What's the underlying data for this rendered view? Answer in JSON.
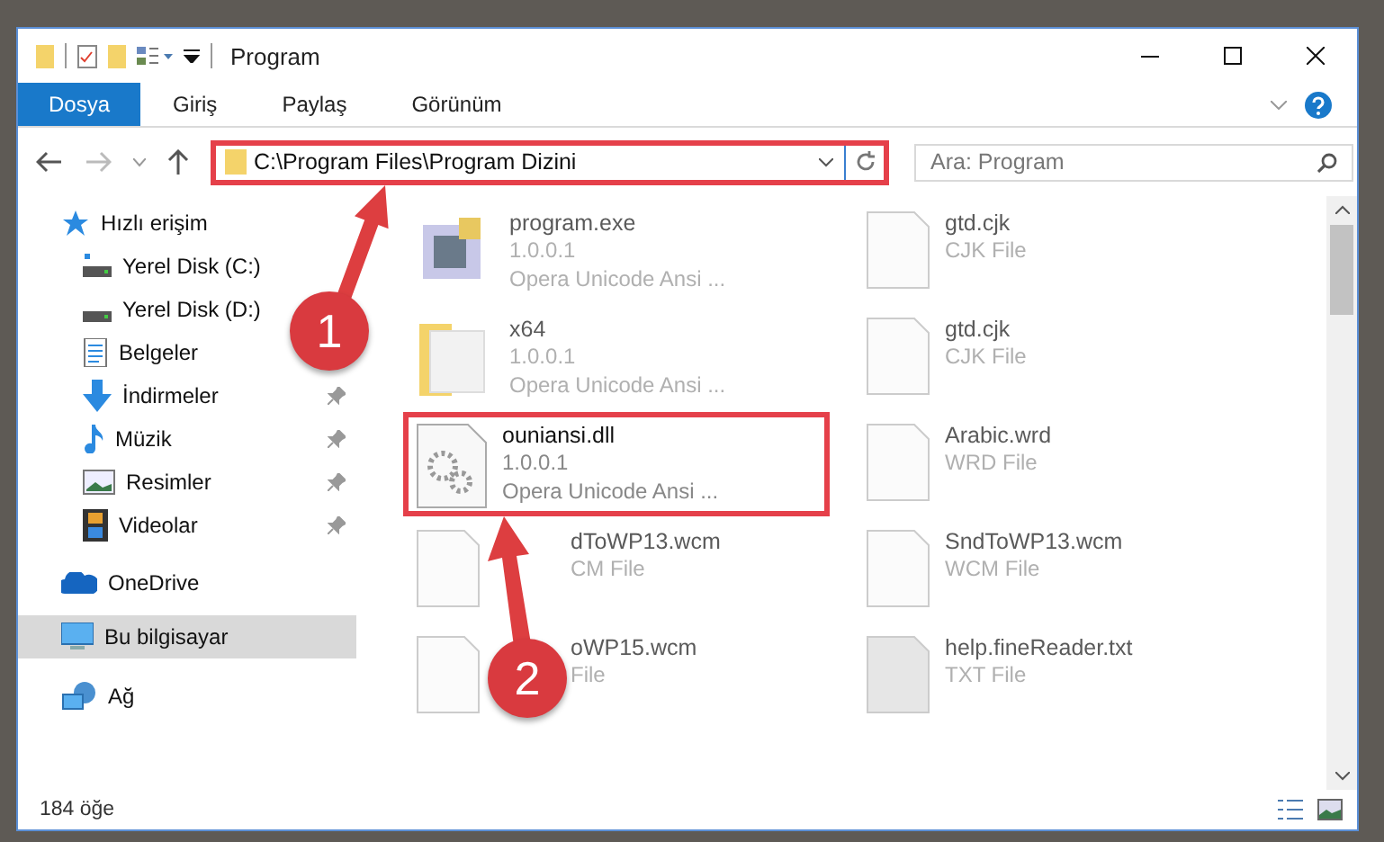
{
  "window": {
    "title": "Program"
  },
  "ribbon_tabs": [
    {
      "label": "Dosya",
      "selected": true
    },
    {
      "label": "Giriş",
      "selected": false
    },
    {
      "label": "Paylaş",
      "selected": false
    },
    {
      "label": "Görünüm",
      "selected": false
    }
  ],
  "address_bar": {
    "path": "C:\\Program Files\\Program Dizini",
    "highlighted": true
  },
  "search": {
    "placeholder": "Ara: Program"
  },
  "sidebar": {
    "items": [
      {
        "label": "Hızlı erişim",
        "kind": "star",
        "selected": false,
        "pinned": false,
        "children": [
          {
            "label": "Yerel Disk (C:)",
            "kind": "drive_c",
            "selected": false,
            "pinned": false
          },
          {
            "label": "Yerel Disk (D:)",
            "kind": "drive",
            "selected": false,
            "pinned": false
          },
          {
            "label": "Belgeler",
            "kind": "document",
            "selected": false,
            "pinned": false
          },
          {
            "label": "İndirmeler",
            "kind": "download",
            "selected": false,
            "pinned": true
          },
          {
            "label": "Müzik",
            "kind": "music",
            "selected": false,
            "pinned": true
          },
          {
            "label": "Resimler",
            "kind": "pictures",
            "selected": false,
            "pinned": true
          },
          {
            "label": "Videolar",
            "kind": "videos",
            "selected": false,
            "pinned": true
          }
        ]
      },
      {
        "label": "OneDrive",
        "kind": "cloud",
        "selected": false,
        "pinned": false
      },
      {
        "label": "Bu bilgisayar",
        "kind": "computer",
        "selected": true,
        "pinned": false
      },
      {
        "label": "Ağ",
        "kind": "network",
        "selected": false,
        "pinned": false
      }
    ]
  },
  "files": [
    {
      "name": "program.exe",
      "details": [
        "1.0.0.1",
        "Opera Unicode Ansi ..."
      ],
      "kind": "app",
      "blurred": true,
      "highlighted": false,
      "partially_hidden": false
    },
    {
      "name": "x64",
      "details": [
        "1.0.0.1",
        "Opera Unicode Ansi ..."
      ],
      "kind": "folder",
      "blurred": true,
      "highlighted": false,
      "partially_hidden": false
    },
    {
      "name": "ouniansi.dll",
      "details": [
        "1.0.0.1",
        "Opera Unicode Ansi ..."
      ],
      "kind": "dll",
      "blurred": false,
      "highlighted": true,
      "partially_hidden": false
    },
    {
      "name": "dToWP13.wcm",
      "details": [
        "CM File"
      ],
      "kind": "file",
      "blurred": true,
      "highlighted": false,
      "partially_hidden": true
    },
    {
      "name": "oWP15.wcm",
      "details": [
        "File"
      ],
      "kind": "file",
      "blurred": true,
      "highlighted": false,
      "partially_hidden": true
    },
    {
      "name": "gtd.cjk",
      "details": [
        "CJK File"
      ],
      "kind": "file",
      "blurred": true,
      "highlighted": false,
      "partially_hidden": false
    },
    {
      "name": "gtd.cjk",
      "details": [
        "CJK File"
      ],
      "kind": "file",
      "blurred": true,
      "highlighted": false,
      "partially_hidden": false
    },
    {
      "name": "Arabic.wrd",
      "details": [
        "WRD File"
      ],
      "kind": "file",
      "blurred": true,
      "highlighted": false,
      "partially_hidden": false
    },
    {
      "name": "SndToWP13.wcm",
      "details": [
        "WCM File"
      ],
      "kind": "file",
      "blurred": true,
      "highlighted": false,
      "partially_hidden": false
    },
    {
      "name": "help.fineReader.txt",
      "details": [
        "TXT File"
      ],
      "kind": "text",
      "blurred": true,
      "highlighted": false,
      "partially_hidden": false
    }
  ],
  "status_bar": {
    "count": "184 öğe"
  },
  "annotations": [
    {
      "label": "1"
    },
    {
      "label": "2"
    }
  ]
}
